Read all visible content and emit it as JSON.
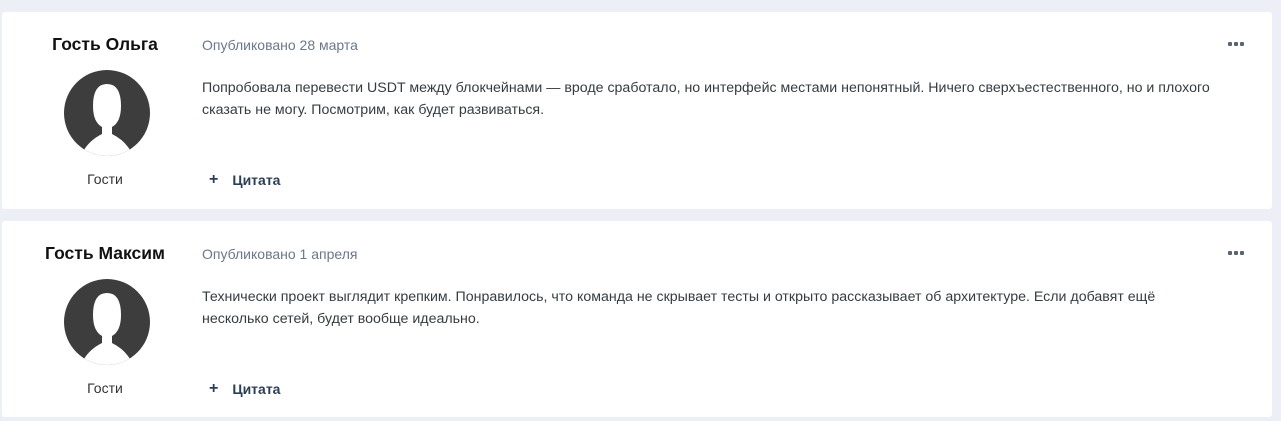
{
  "posts": [
    {
      "author": "Гость Ольга",
      "group": "Гости",
      "date": "Опубликовано 28 марта",
      "body": "Попробовала перевести USDT между блокчейнами — вроде сработало, но интерфейс местами непонятный. Ничего сверхъестественного, но и плохого сказать не могу. Посмотрим, как будет развиваться.",
      "quote_icon": "plus-icon",
      "quote_label": "Цитата",
      "menu_icon": "ellipsis-icon"
    },
    {
      "author": "Гость Максим",
      "group": "Гости",
      "date": "Опубликовано 1 апреля",
      "body": "Технически проект выглядит крепким. Понравилось, что команда не скрывает тесты и открыто рассказывает об архитектуре. Если добавят ещё несколько сетей, будет вообще идеально.",
      "quote_icon": "plus-icon",
      "quote_label": "Цитата",
      "menu_icon": "ellipsis-icon"
    }
  ],
  "colors": {
    "page_background": "#eceff5",
    "card_background": "#ffffff",
    "avatar": "#3d3d3d",
    "meta_text": "#6b778b",
    "action_text": "#2a3f55"
  }
}
